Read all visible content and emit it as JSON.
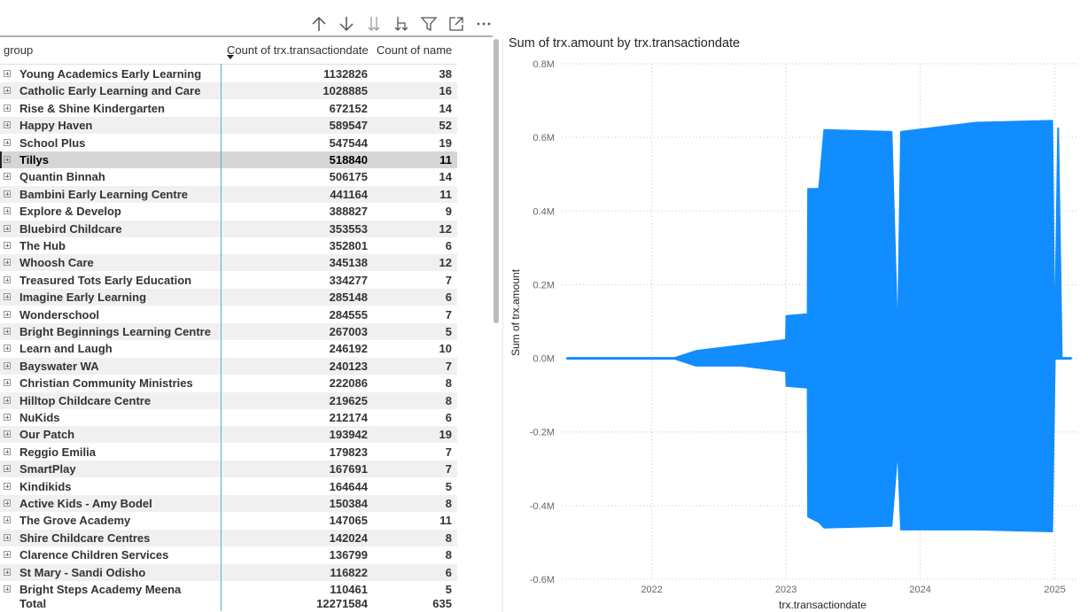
{
  "toolbar": {
    "icons": [
      "drill-up-icon",
      "drill-down-icon",
      "expand-next-level-icon",
      "expand-all-down-icon",
      "filter-icon",
      "focus-mode-icon",
      "more-options-icon"
    ]
  },
  "table": {
    "headers": {
      "group": "group",
      "count_date": "Count of trx.transactiondate",
      "count_name": "Count of name"
    },
    "sort_column": "count_date",
    "rows": [
      {
        "group": "Young Academics Early Learning",
        "count_date": "1132826",
        "count_name": "38"
      },
      {
        "group": "Catholic Early Learning and Care",
        "count_date": "1028885",
        "count_name": "16"
      },
      {
        "group": "Rise & Shine Kindergarten",
        "count_date": "672152",
        "count_name": "14"
      },
      {
        "group": "Happy Haven",
        "count_date": "589547",
        "count_name": "52"
      },
      {
        "group": "School Plus",
        "count_date": "547544",
        "count_name": "19"
      },
      {
        "group": "Tillys",
        "count_date": "518840",
        "count_name": "11",
        "selected": true
      },
      {
        "group": "Quantin Binnah",
        "count_date": "506175",
        "count_name": "14"
      },
      {
        "group": "Bambini Early Learning Centre",
        "count_date": "441164",
        "count_name": "11"
      },
      {
        "group": "Explore & Develop",
        "count_date": "388827",
        "count_name": "9"
      },
      {
        "group": "Bluebird Childcare",
        "count_date": "353553",
        "count_name": "12"
      },
      {
        "group": "The Hub",
        "count_date": "352801",
        "count_name": "6"
      },
      {
        "group": "Whoosh Care",
        "count_date": "345138",
        "count_name": "12"
      },
      {
        "group": "Treasured Tots Early Education",
        "count_date": "334277",
        "count_name": "7"
      },
      {
        "group": "Imagine Early Learning",
        "count_date": "285148",
        "count_name": "6"
      },
      {
        "group": "Wonderschool",
        "count_date": "284555",
        "count_name": "7"
      },
      {
        "group": "Bright Beginnings Learning Centre",
        "count_date": "267003",
        "count_name": "5"
      },
      {
        "group": "Learn and Laugh",
        "count_date": "246192",
        "count_name": "10"
      },
      {
        "group": "Bayswater WA",
        "count_date": "240123",
        "count_name": "7"
      },
      {
        "group": "Christian Community Ministries",
        "count_date": "222086",
        "count_name": "8"
      },
      {
        "group": "Hilltop Childcare Centre",
        "count_date": "219625",
        "count_name": "8"
      },
      {
        "group": "NuKids",
        "count_date": "212174",
        "count_name": "6"
      },
      {
        "group": "Our Patch",
        "count_date": "193942",
        "count_name": "19"
      },
      {
        "group": "Reggio Emilia",
        "count_date": "179823",
        "count_name": "7"
      },
      {
        "group": "SmartPlay",
        "count_date": "167691",
        "count_name": "7"
      },
      {
        "group": "Kindikids",
        "count_date": "164644",
        "count_name": "5"
      },
      {
        "group": "Active Kids - Amy Bodel",
        "count_date": "150384",
        "count_name": "8"
      },
      {
        "group": "The Grove Academy",
        "count_date": "147065",
        "count_name": "11"
      },
      {
        "group": "Shire Childcare Centres",
        "count_date": "142024",
        "count_name": "8"
      },
      {
        "group": "Clarence Children Services",
        "count_date": "136799",
        "count_name": "8"
      },
      {
        "group": "St Mary - Sandi Odisho",
        "count_date": "116822",
        "count_name": "6"
      },
      {
        "group": "Bright Steps Academy Meena",
        "count_date": "110461",
        "count_name": "5"
      }
    ],
    "total": {
      "label": "Total",
      "count_date": "12271584",
      "count_name": "635"
    }
  },
  "chart_data": {
    "type": "area",
    "title": "Sum of trx.amount by trx.transactiondate",
    "xlabel": "trx.transactiondate",
    "ylabel": "Sum of trx.amount",
    "xlim": [
      "2021-05-01",
      "2025-03-01"
    ],
    "ylim": [
      -600000,
      800000
    ],
    "x_ticks": [
      "2022",
      "2023",
      "2024",
      "2025"
    ],
    "y_ticks": [
      "0.8M",
      "0.6M",
      "0.4M",
      "0.2M",
      "0.0M",
      "-0.2M",
      "-0.4M",
      "-0.6M"
    ],
    "grid": "horizontal dotted",
    "series": [
      {
        "color": "#118dff",
        "envelope": [
          {
            "date": "2021-05-15",
            "max": 0,
            "min": 0
          },
          {
            "date": "2022-03-01",
            "max": 0,
            "min": 0
          },
          {
            "date": "2022-05-01",
            "max": 20000,
            "min": -20000
          },
          {
            "date": "2022-09-01",
            "max": 35000,
            "min": -20000
          },
          {
            "date": "2023-01-01",
            "max": 50000,
            "min": -35000
          },
          {
            "date": "2023-01-02",
            "max": 115000,
            "min": -75000
          },
          {
            "date": "2023-03-01",
            "max": 120000,
            "min": -80000
          },
          {
            "date": "2023-03-02",
            "max": 460000,
            "min": -430000
          },
          {
            "date": "2023-04-01",
            "max": 460000,
            "min": -445000
          },
          {
            "date": "2023-04-15",
            "max": 620000,
            "min": -460000
          },
          {
            "date": "2023-10-15",
            "max": 615000,
            "min": -455000
          },
          {
            "date": "2023-11-01",
            "max": 25000,
            "min": -240000
          },
          {
            "date": "2023-11-10",
            "max": 615000,
            "min": -465000
          },
          {
            "date": "2024-06-01",
            "max": 640000,
            "min": -465000
          },
          {
            "date": "2024-12-25",
            "max": 645000,
            "min": -470000
          },
          {
            "date": "2025-01-01",
            "max": 0,
            "min": 0
          },
          {
            "date": "2025-01-10",
            "max": 625000,
            "min": 0
          },
          {
            "date": "2025-01-20",
            "max": 0,
            "min": 0
          },
          {
            "date": "2025-02-15",
            "max": 0,
            "min": 0
          }
        ]
      }
    ]
  }
}
